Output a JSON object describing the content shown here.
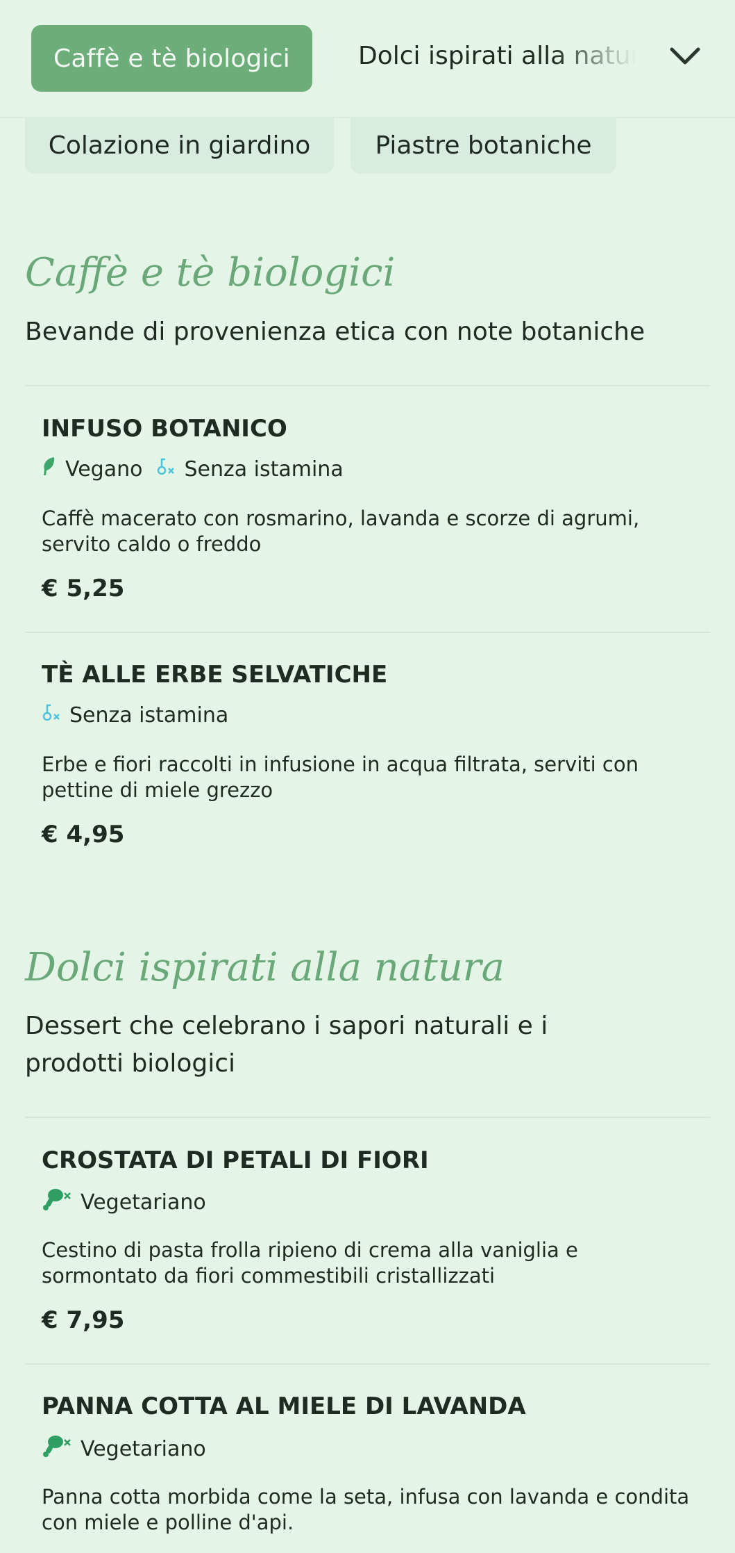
{
  "nav": {
    "active_tab": "Caffè e tè biologici",
    "next_tab": "Dolci ispirati alla natura",
    "row2": [
      "Colazione in giardino",
      "Piastre botaniche"
    ]
  },
  "sections": [
    {
      "title": "Caffè e tè biologici",
      "description": "Bevande di provenienza etica con note botaniche",
      "items": [
        {
          "name": "INFUSO BOTANICO",
          "tags": [
            "Vegano",
            "Senza istamina"
          ],
          "description": "Caffè macerato con rosmarino, lavanda e scorze di agrumi, servito caldo o freddo",
          "price": "€ 5,25"
        },
        {
          "name": "TÈ ALLE ERBE SELVATICHE",
          "tags": [
            "Senza istamina"
          ],
          "description": "Erbe e fiori raccolti in infusione in acqua filtrata, serviti con pettine di miele grezzo",
          "price": "€ 4,95"
        }
      ]
    },
    {
      "title": "Dolci ispirati alla natura",
      "description": "Dessert che celebrano i sapori naturali e i prodotti biologici",
      "items": [
        {
          "name": "CROSTATA DI PETALI DI FIORI",
          "tags": [
            "Vegetariano"
          ],
          "description": "Cestino di pasta frolla ripieno di crema alla vaniglia e sormontato da fiori commestibili cristallizzati",
          "price": "€ 7,95"
        },
        {
          "name": "PANNA COTTA AL MIELE DI LAVANDA",
          "tags": [
            "Vegetariano"
          ],
          "description": "Panna cotta morbida come la seta, infusa con lavanda e condita con miele e polline d'api."
        }
      ]
    }
  ],
  "colors": {
    "background": "#e4f5e8",
    "accent": "#6cad7a",
    "vegan_icon": "#3fa56a",
    "histamine_icon": "#4cc3d9",
    "vegetarian_icon": "#2e9e62"
  },
  "icons": {
    "vegan": "leaf-icon",
    "histamine_free": "histamine-free-icon",
    "vegetarian": "drumstick-crossed-icon",
    "dropdown": "chevron-down-icon"
  }
}
